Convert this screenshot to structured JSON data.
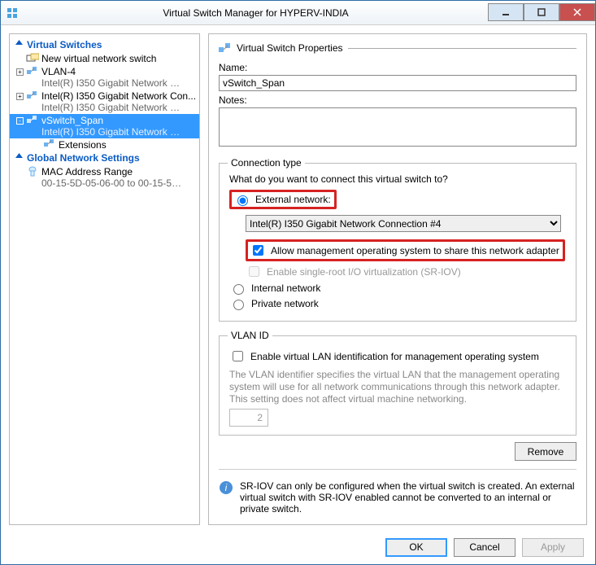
{
  "window": {
    "title": "Virtual Switch Manager for HYPERV-INDIA"
  },
  "tree": {
    "h1": "Virtual Switches",
    "new_switch": "New virtual network switch",
    "items": [
      {
        "name": "VLAN-4",
        "sub": "Intel(R) I350 Gigabit Network Con..."
      },
      {
        "name": "Intel(R) I350 Gigabit Network Con...",
        "sub": "Intel(R) I350 Gigabit Network Con..."
      },
      {
        "name": "vSwitch_Span",
        "sub": "Intel(R) I350 Gigabit Network Con..."
      }
    ],
    "ext_child": "Extensions",
    "h2": "Global Network Settings",
    "mac": {
      "name": "MAC Address Range",
      "sub": "00-15-5D-05-06-00 to 00-15-5D-0..."
    }
  },
  "props": {
    "title": "Virtual Switch Properties",
    "name_label": "Name:",
    "name_value": "vSwitch_Span",
    "notes_label": "Notes:",
    "ct_legend": "Connection type",
    "ct_question": "What do you want to connect this virtual switch to?",
    "ext_label": "External network:",
    "nic_value": "Intel(R) I350 Gigabit Network Connection #4",
    "allow_label": "Allow management operating system to share this network adapter",
    "sriov_label": "Enable single-root I/O virtualization (SR-IOV)",
    "int_label": "Internal network",
    "priv_label": "Private network",
    "vlan_legend": "VLAN ID",
    "vlan_enable": "Enable virtual LAN identification for management operating system",
    "vlan_help": "The VLAN identifier specifies the virtual LAN that the management operating system will use for all network communications through this network adapter. This setting does not affect virtual machine networking.",
    "vlan_value": "2",
    "remove": "Remove",
    "sriov_info": "SR-IOV can only be configured when the virtual switch is created. An external virtual switch with SR-IOV enabled cannot be converted to an internal or private switch."
  },
  "footer": {
    "ok": "OK",
    "cancel": "Cancel",
    "apply": "Apply"
  }
}
